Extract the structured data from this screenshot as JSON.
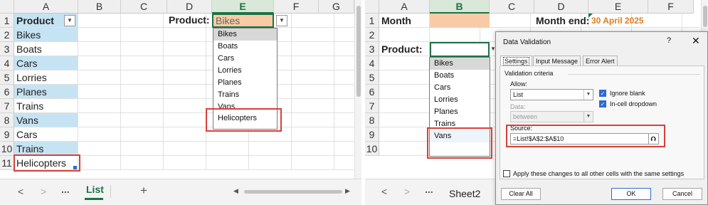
{
  "left": {
    "columns": [
      "A",
      "B",
      "C",
      "D",
      "E",
      "F",
      "G"
    ],
    "rows": [
      "1",
      "2",
      "3",
      "4",
      "5",
      "6",
      "7",
      "8",
      "9",
      "10",
      "11"
    ],
    "header_cell": "Product",
    "products": [
      "Bikes",
      "Boats",
      "Cars",
      "Lorries",
      "Planes",
      "Trains",
      "Vans",
      "Cars",
      "Trains",
      "Helicopters"
    ],
    "product_label": "Product:",
    "product_value": "Bikes",
    "dropdown_items": [
      "Bikes",
      "Boats",
      "Cars",
      "Lorries",
      "Planes",
      "Trains",
      "Vans",
      "Helicopters"
    ],
    "sheet_tab": "List",
    "nav_dots": "...",
    "add_sheet": "+"
  },
  "right": {
    "columns": [
      "A",
      "B",
      "C",
      "D",
      "E",
      "F"
    ],
    "rows": [
      "1",
      "2",
      "3",
      "4",
      "5",
      "6",
      "7",
      "8",
      "9",
      "10"
    ],
    "month_label": "Month",
    "month_end_label": "Month end:",
    "month_end_value": "30 April 2025",
    "product_label": "Product:",
    "dropdown_items": [
      "Bikes",
      "Boats",
      "Cars",
      "Lorries",
      "Planes",
      "Trains",
      "Vans"
    ],
    "sheet_tab": "Sheet2",
    "nav_dots": "..."
  },
  "dialog": {
    "title": "Data Validation",
    "help": "?",
    "close": "✕",
    "tabs": [
      "Settings",
      "Input Message",
      "Error Alert"
    ],
    "section": "Validation criteria",
    "allow_label": "Allow:",
    "allow_value": "List",
    "ignore_blank": "Ignore blank",
    "in_cell_dropdown": "In-cell dropdown",
    "data_label": "Data:",
    "data_value": "between",
    "source_label": "Source:",
    "source_value": "=List!$A$2:$A$10",
    "apply_all": "Apply these changes to all other cells with the same settings",
    "clear_all": "Clear All",
    "ok": "OK",
    "cancel": "Cancel"
  },
  "colors": {
    "band": "#c5e3f3",
    "peach": "#f8cba6",
    "accent": "#1e7145",
    "orange_text": "#e07b1f",
    "highlight_red": "#d9403a"
  }
}
